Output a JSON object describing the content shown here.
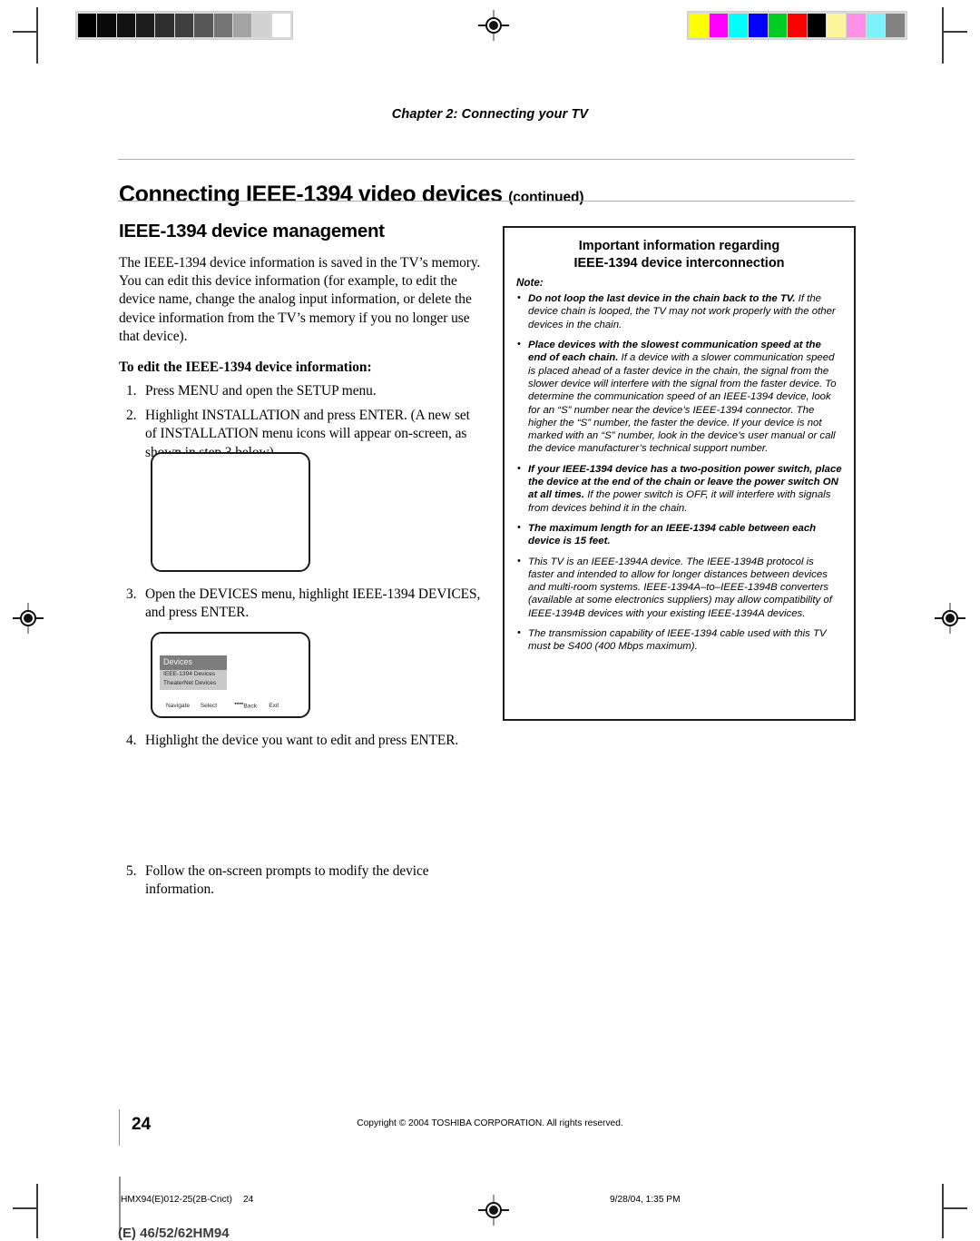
{
  "printmarks": {
    "grayscale": [
      "#000000",
      "#0a0a0a",
      "#121212",
      "#1d1d1d",
      "#2e2e2e",
      "#3f3f3f",
      "#585858",
      "#757575",
      "#a3a3a3",
      "#d2d2d2",
      "#ffffff"
    ],
    "colors": [
      "#ffff00",
      "#ff00ff",
      "#00ffff",
      "#0000ff",
      "#00cc22",
      "#ff0000",
      "#000000",
      "#fdf59a",
      "#fd8fe6",
      "#7ef2fa",
      "#828282"
    ],
    "registration_icon": "registration-target-icon"
  },
  "chapter": "Chapter 2: Connecting your TV",
  "title": {
    "main": "Connecting IEEE-1394 video devices",
    "continued": "(continued)"
  },
  "left": {
    "section_heading": "IEEE-1394 device management",
    "intro": "The IEEE-1394 device information is saved in the TV’s memory. You can edit this device information (for example, to edit the device name, change the analog input information, or delete the device information from the TV’s memory if you no longer use that device).",
    "subheading": "To edit the IEEE-1394 device information:",
    "steps": [
      {
        "num": "1.",
        "text": "Press MENU and open the SETUP menu."
      },
      {
        "num": "2.",
        "text": "Highlight INSTALLATION and press ENTER. (A new set of INSTALLATION menu icons will appear on-screen, as shown in step 3 below)."
      },
      {
        "num": "3.",
        "text": "Open the DEVICES menu, highlight IEEE-1394 DEVICES, and press ENTER."
      },
      {
        "num": "4.",
        "text": "Highlight the device you want to edit and press ENTER."
      },
      {
        "num": "5.",
        "text": "Follow the on-screen prompts to modify the device information."
      }
    ]
  },
  "osd": {
    "menu_title": "Devices",
    "items": [
      "IEEE-1394 Devices",
      "TheaterNet Devices"
    ],
    "bottom_bar": [
      {
        "label": "Navigate",
        "glyph": ""
      },
      {
        "label": "Select",
        "glyph": ""
      },
      {
        "label": "Back",
        "glyph": "■■■■"
      },
      {
        "label": "Exit",
        "glyph": ""
      }
    ]
  },
  "infobox": {
    "title_line1": "Important information regarding",
    "title_line2": "IEEE-1394 device interconnection",
    "note_label": "Note:",
    "bullets": [
      {
        "bold": "Do not loop the last device in the chain back to the TV.",
        "rest": " If the device chain is looped, the TV may not work properly with the other devices in the chain."
      },
      {
        "bold": "Place devices with the slowest communication speed at the end of each chain.",
        "rest": " If a device with a slower communication speed is placed ahead of a faster device in the chain, the signal from the slower device will interfere with the signal from the faster device. To determine the communication speed of an IEEE-1394 device, look for an “S” number near the device’s IEEE-1394 connector. The higher the “S” number, the faster the device. If your device is not marked with an “S” number, look in the device’s user manual or call the device manufacturer’s technical support number."
      },
      {
        "bold": "If your IEEE-1394 device has a two-position power switch, place the device at the end of the chain or leave the power switch ON at all times.",
        "rest": " If the power switch is OFF, it will interfere with signals from devices behind it in the chain."
      },
      {
        "bold": "The maximum length for an IEEE-1394 cable between each device is 15 feet.",
        "rest": ""
      },
      {
        "bold": "",
        "rest": "This TV is an IEEE-1394A device. The IEEE-1394B protocol is faster and intended to allow for longer distances between devices and multi-room systems. IEEE-1394A–to–IEEE-1394B converters (available at some electronics suppliers) may allow compatibility of IEEE-1394B devices with your existing IEEE-1394A devices."
      },
      {
        "bold": "",
        "rest": "The transmission capability of IEEE-1394 cable used with this TV must be S400 (400 Mbps maximum)."
      }
    ]
  },
  "footer": {
    "page_number": "24",
    "copyright": "Copyright © 2004 TOSHIBA CORPORATION. All rights reserved.",
    "production_file": "HMX94(E)012-25(2B-Cnct)",
    "production_page": "24",
    "production_date": "9/28/04, 1:35 PM",
    "model": "(E) 46/52/62HM94"
  }
}
